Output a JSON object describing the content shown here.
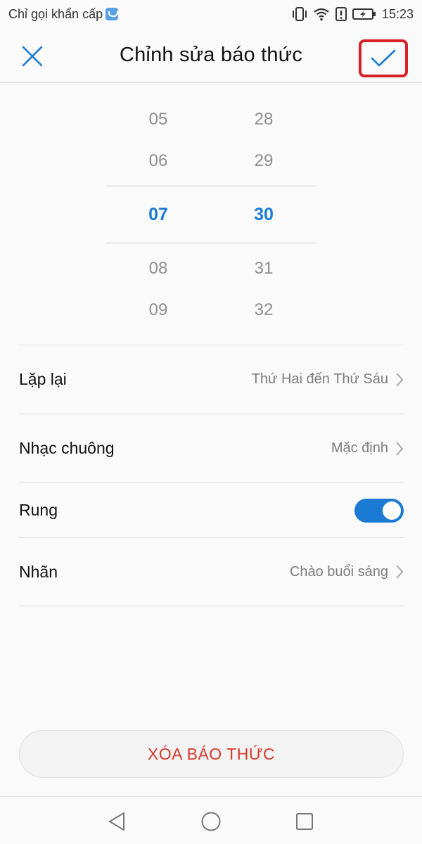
{
  "status_bar": {
    "carrier": "Chỉ gọi khẩn cấp",
    "time": "15:23",
    "icons": [
      "sim-icon",
      "vibrate-icon",
      "wifi-icon",
      "alert-icon",
      "battery-charging-icon"
    ]
  },
  "app_bar": {
    "title": "Chỉnh sửa báo thức",
    "close_icon": "close-icon",
    "confirm_icon": "checkmark-icon"
  },
  "time_picker": {
    "hours": [
      "05",
      "06",
      "07",
      "08",
      "09"
    ],
    "minutes": [
      "28",
      "29",
      "30",
      "31",
      "32"
    ],
    "selected_hour": "07",
    "selected_minute": "30"
  },
  "settings": {
    "repeat": {
      "label": "Lặp lại",
      "value": "Thứ Hai đến Thứ Sáu"
    },
    "ringtone": {
      "label": "Nhạc chuông",
      "value": "Mặc định"
    },
    "vibrate": {
      "label": "Rung",
      "enabled": true
    },
    "label": {
      "label": "Nhãn",
      "value": "Chào buổi sáng"
    }
  },
  "delete_button": {
    "label": "XÓA BÁO THỨC"
  },
  "colors": {
    "accent": "#1a7ad4",
    "danger": "#d63a2c",
    "highlight_box": "#d6202a"
  },
  "nav_bar": {
    "icons": [
      "back-icon",
      "home-icon",
      "recents-icon"
    ]
  }
}
